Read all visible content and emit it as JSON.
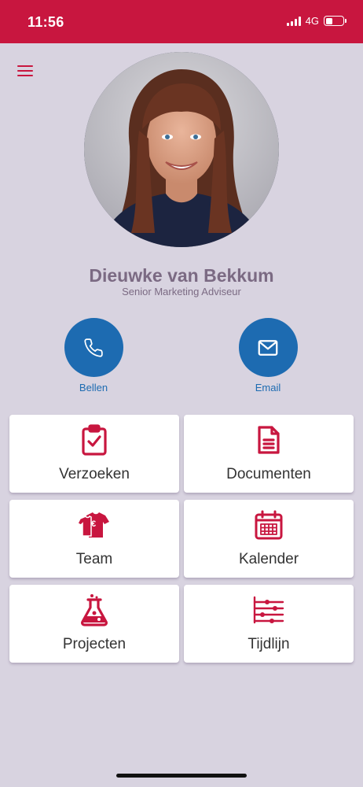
{
  "status": {
    "time": "11:56",
    "network": "4G",
    "battery_level": 0.4
  },
  "profile": {
    "name": "Dieuwke van Bekkum",
    "role": "Senior Marketing Adviseur"
  },
  "actions": [
    {
      "label": "Bellen",
      "icon": "phone-icon"
    },
    {
      "label": "Email",
      "icon": "mail-icon"
    }
  ],
  "tiles": [
    {
      "label": "Verzoeken",
      "icon": "clipboard-check-icon"
    },
    {
      "label": "Documenten",
      "icon": "document-icon"
    },
    {
      "label": "Team",
      "icon": "team-shirt-icon"
    },
    {
      "label": "Kalender",
      "icon": "calendar-icon"
    },
    {
      "label": "Projecten",
      "icon": "flask-icon"
    },
    {
      "label": "Tijdlijn",
      "icon": "timeline-icon"
    }
  ],
  "colors": {
    "brand": "#c8163f",
    "action": "#1d6bb1",
    "background": "#d8d3e0",
    "name_text": "#7b6a83"
  }
}
